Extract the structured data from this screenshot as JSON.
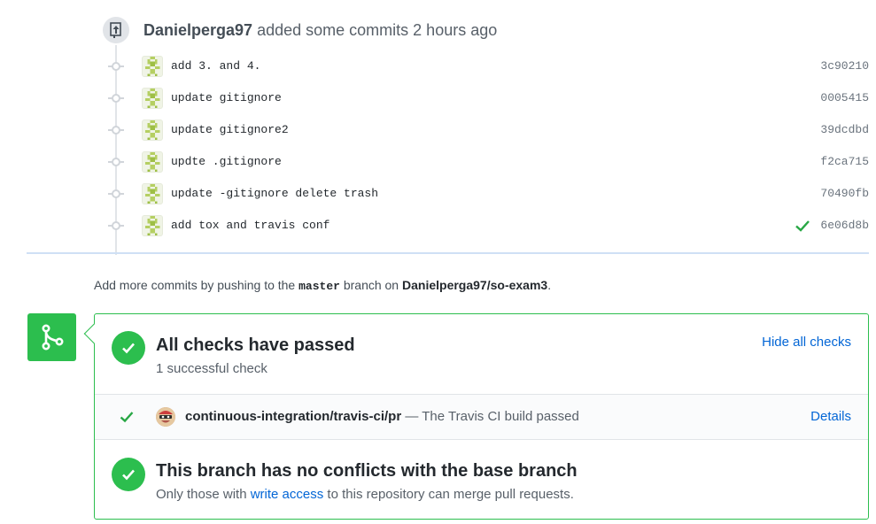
{
  "event": {
    "author": "Danielperga97",
    "action": "added some commits",
    "time": "2 hours ago"
  },
  "commits": [
    {
      "message": "add 3. and 4.",
      "sha": "3c90210",
      "verified": false
    },
    {
      "message": "update gitignore",
      "sha": "0005415",
      "verified": false
    },
    {
      "message": "update gitignore2",
      "sha": "39dcdbd",
      "verified": false
    },
    {
      "message": "updte .gitignore",
      "sha": "f2ca715",
      "verified": false
    },
    {
      "message": "update -gitignore delete trash",
      "sha": "70490fb",
      "verified": false
    },
    {
      "message": "add tox and travis conf",
      "sha": "6e06d8b",
      "verified": true
    }
  ],
  "push_note": {
    "prefix": "Add more commits by pushing to the",
    "branch": "master",
    "middle": "branch on",
    "repo": "Danielperga97/so-exam3",
    "suffix": "."
  },
  "checks": {
    "title": "All checks have passed",
    "subtitle": "1 successful check",
    "hide_label": "Hide all checks",
    "items": [
      {
        "context": "continuous-integration/travis-ci/pr",
        "separator": "—",
        "description": "The Travis CI build passed",
        "details_label": "Details"
      }
    ]
  },
  "merge_status": {
    "title": "This branch has no conflicts with the base branch",
    "sub_prefix": "Only those with",
    "sub_link": "write access",
    "sub_suffix": "to this repository can merge pull requests."
  },
  "colors": {
    "success": "#2cbe4e",
    "link": "#0366d6",
    "check_mark": "#28a745"
  },
  "icons": {
    "event": "repo-push-icon",
    "commit_node": "git-commit-icon",
    "merge": "git-merge-icon",
    "check": "check-icon"
  }
}
